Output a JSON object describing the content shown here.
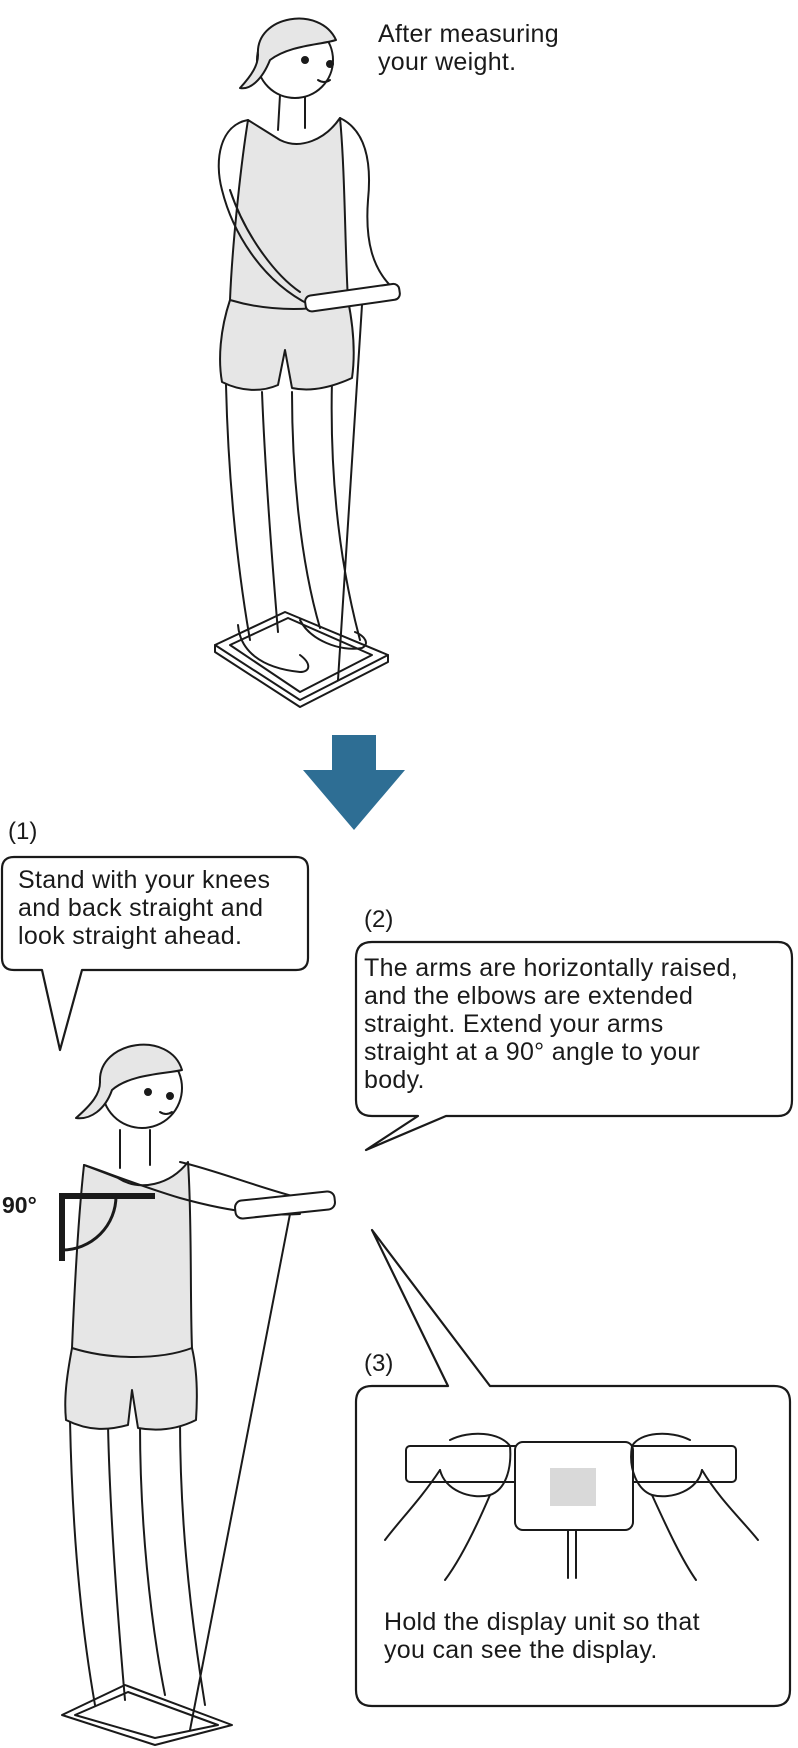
{
  "caption_top": "After measuring\nyour weight.",
  "arrow_color": "#2e6e94",
  "steps": [
    {
      "number": "(1)",
      "text": "Stand with your knees\nand back straight and\nlook straight ahead."
    },
    {
      "number": "(2)",
      "text": "The arms are horizontally raised,\nand the elbows are extended\nstraight. Extend your arms\nstraight at a 90° angle to your\nbody."
    },
    {
      "number": "(3)",
      "text": "Hold the display unit so that\nyou can see the display."
    }
  ],
  "angle_label": "90°",
  "display_unit": {
    "screen_color": "#d9d9d9"
  }
}
